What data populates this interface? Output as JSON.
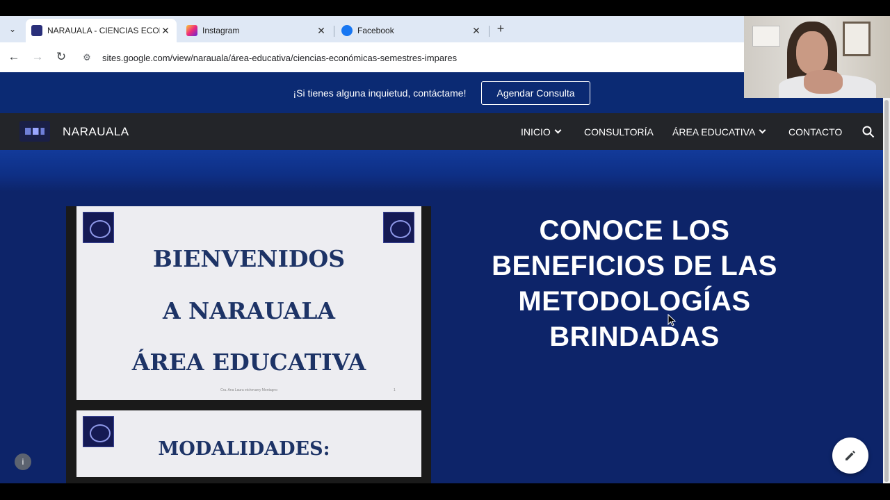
{
  "browser": {
    "tabs": [
      {
        "title": "NARAUALA - CIENCIAS ECONÓ",
        "favicon": "narauala-favicon",
        "active": true
      },
      {
        "title": "Instagram",
        "favicon": "instagram-icon",
        "active": false
      },
      {
        "title": "Facebook",
        "favicon": "facebook-icon",
        "active": false
      }
    ],
    "url": "sites.google.com/view/narauala/área-educativa/ciencias-económicas-semestres-impares"
  },
  "banner": {
    "text": "¡Si tienes alguna inquietud, contáctame!",
    "button": "Agendar Consulta"
  },
  "site": {
    "name": "NARAUALA",
    "menu": [
      {
        "label": "INICIO",
        "dropdown": true
      },
      {
        "label": "CONSULTORÍA",
        "dropdown": false
      },
      {
        "label": "ÁREA EDUCATIVA",
        "dropdown": true
      },
      {
        "label": "CONTACTO",
        "dropdown": false
      }
    ]
  },
  "slides": {
    "slide1": {
      "line1": "BIENVENIDOS",
      "line2": "A NARAUALA",
      "line3": "ÁREA EDUCATIVA",
      "footer": "Cra. Ana Laura etchevarry Montagno",
      "page_number": "1"
    },
    "slide2": {
      "title": "MODALIDADES:"
    }
  },
  "headline": "CONOCE LOS BENEFICIOS DE LAS METODOLOGÍAS BRINDADAS",
  "colors": {
    "page_bg": "#0d2469",
    "banner_bg": "#0b2a73",
    "nav_bg": "#232529",
    "slide_text": "#1d3366"
  }
}
